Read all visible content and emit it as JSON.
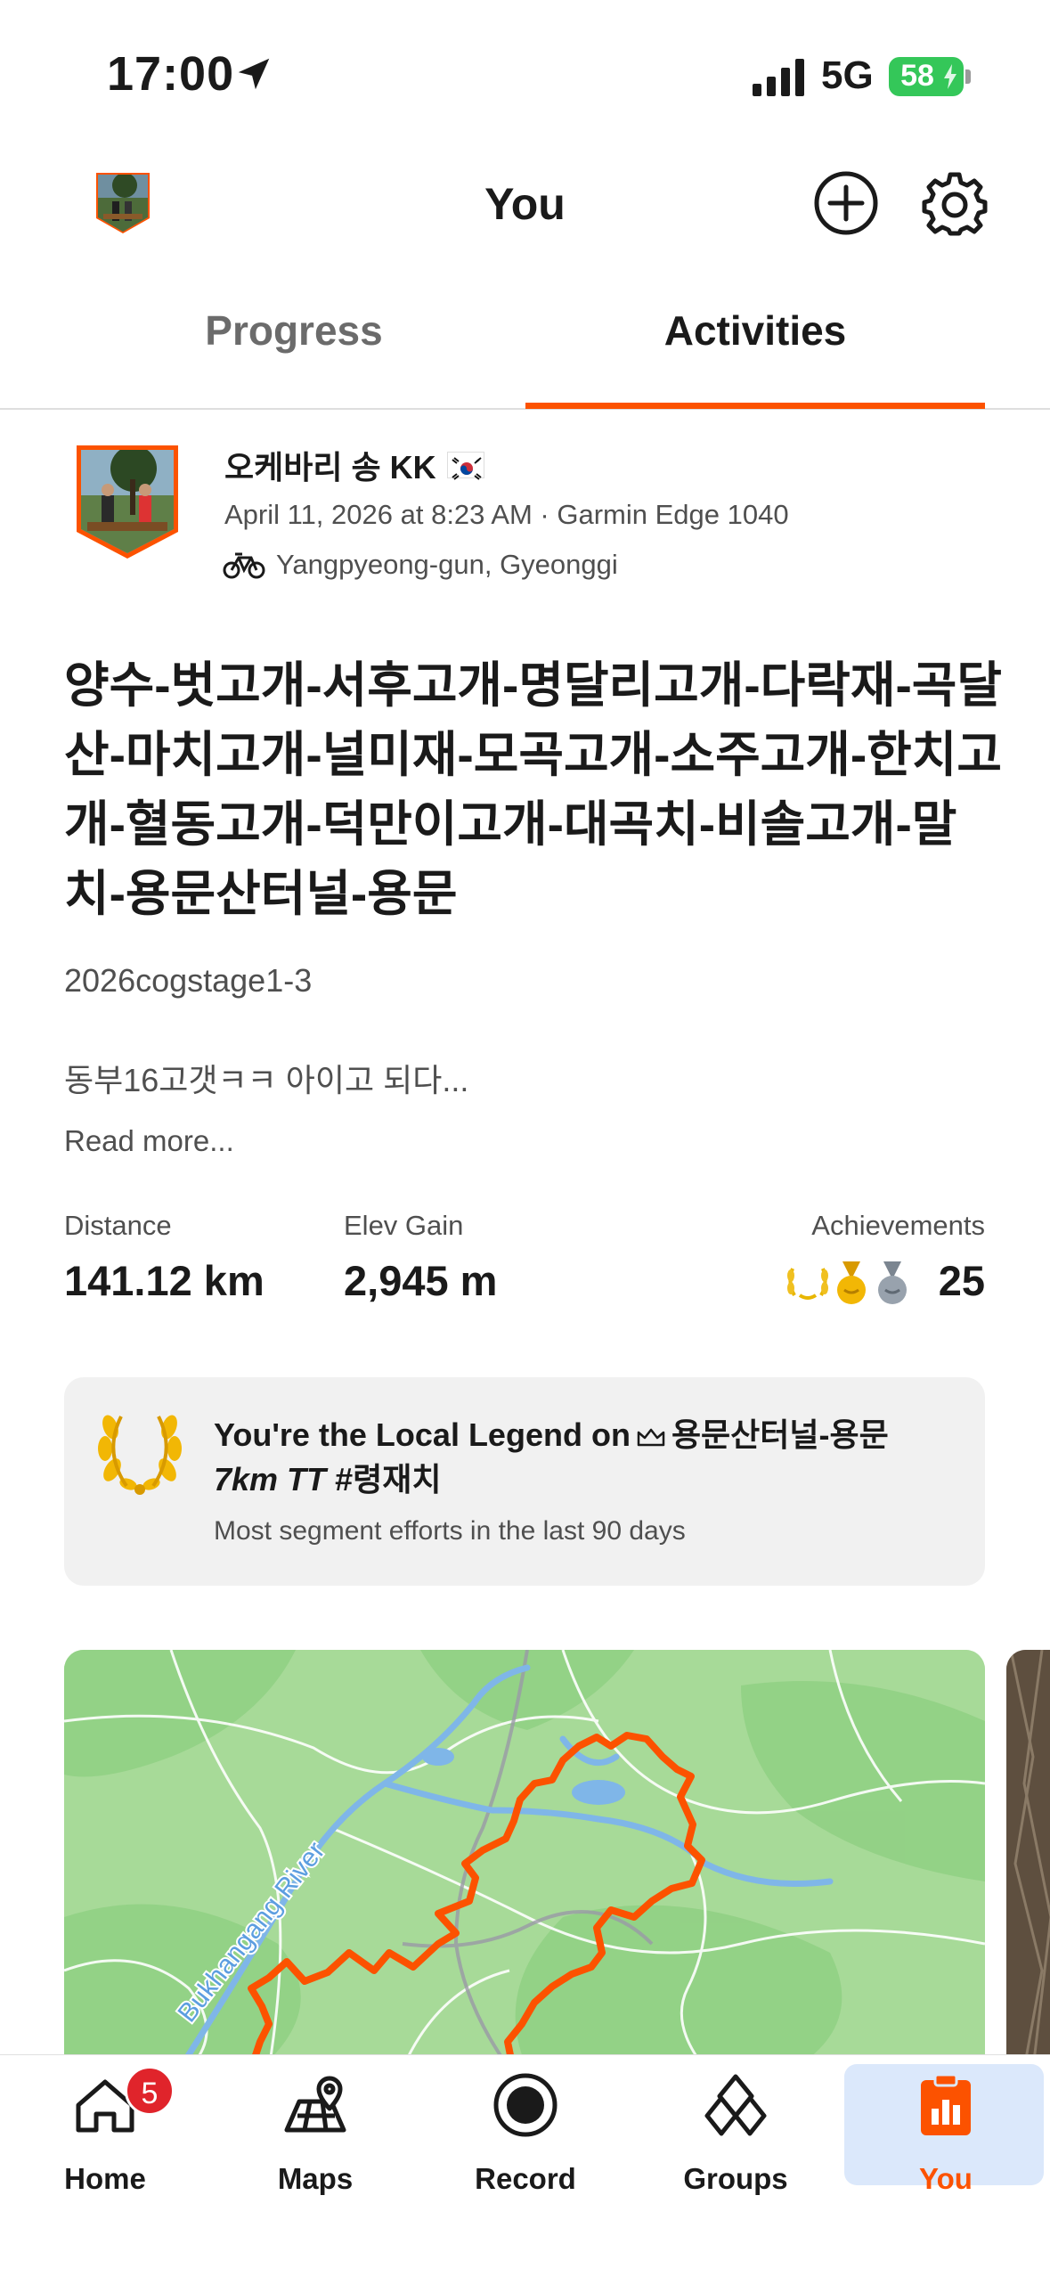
{
  "status_bar": {
    "time": "17:00",
    "network": "5G",
    "battery": "58"
  },
  "header": {
    "title": "You"
  },
  "tabs": [
    {
      "label": "Progress",
      "active": false
    },
    {
      "label": "Activities",
      "active": true
    }
  ],
  "activity": {
    "athlete_name": "오케바리 송 KK",
    "meta": "April 11, 2026 at 8:23 AM · Garmin Edge 1040",
    "location": "Yangpyeong-gun, Gyeonggi",
    "title": "양수-벗고개-서후고개-명달리고개-다락재-곡달산-마치고개-널미재-모곡고개-소주고개-한치고개-혈동고개-덕만이고개-대곡치-비솔고개-말치-용문산터널-용문",
    "tag": "2026cogstage1-3",
    "description": "동부16고갯ㅋㅋ 아이고 되다...",
    "read_more": "Read more...",
    "stats": {
      "distance_label": "Distance",
      "distance_value": "141.12 km",
      "elev_label": "Elev Gain",
      "elev_value": "2,945 m",
      "achievements_label": "Achievements",
      "achievements_value": "25"
    },
    "local_legend": {
      "title_prefix": "You're the Local Legend on",
      "segment": "용문산터널-용문",
      "segment_suffix": "7km TT",
      "hashtag": "#령재치",
      "subtitle": "Most segment efforts in the last 90 days"
    },
    "map": {
      "river_label": "Bukhangang River"
    }
  },
  "bottom_nav": {
    "items": [
      {
        "label": "Home",
        "icon": "home-icon",
        "badge": "5"
      },
      {
        "label": "Maps",
        "icon": "maps-icon"
      },
      {
        "label": "Record",
        "icon": "record-icon"
      },
      {
        "label": "Groups",
        "icon": "groups-icon"
      },
      {
        "label": "You",
        "icon": "you-icon",
        "active": true
      }
    ]
  },
  "colors": {
    "accent": "#fc5200",
    "route": "#fc5200",
    "map_green": "#a9dc9c",
    "active_tab_bg": "#dbe8fb",
    "badge_red": "#e0242b",
    "battery_green": "#34c759"
  }
}
